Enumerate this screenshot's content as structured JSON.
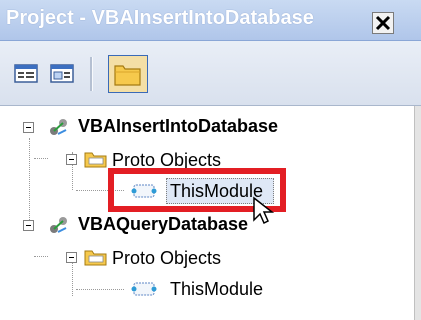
{
  "window": {
    "title": "Project - VBAInsertIntoDatabase",
    "close_label": "×"
  },
  "toolbar": {
    "buttons": [
      {
        "name": "view-code",
        "icon": "view-code-icon"
      },
      {
        "name": "view-object",
        "icon": "view-object-icon"
      },
      {
        "name": "toggle-folders",
        "icon": "folder-icon",
        "active": true
      }
    ]
  },
  "tree": {
    "projects": [
      {
        "label": "VBAInsertIntoDatabase",
        "folder": "Proto Objects",
        "module": "ThisModule",
        "module_selected": true
      },
      {
        "label": "VBAQueryDatabase",
        "folder": "Proto Objects",
        "module": "ThisModule",
        "module_selected": false
      }
    ]
  },
  "colors": {
    "titlebar": "#b8cdee",
    "highlight_box": "#e31e24",
    "selection": "#dfe8f6"
  }
}
